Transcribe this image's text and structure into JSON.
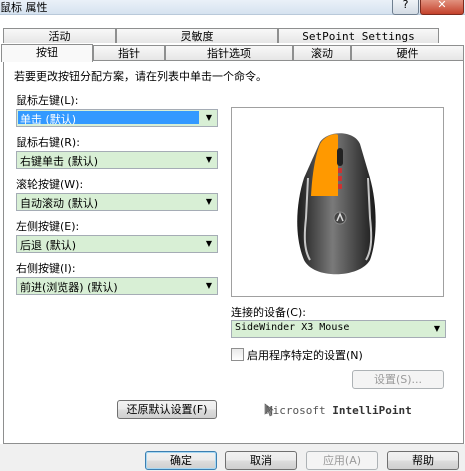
{
  "window": {
    "title": "鼠标 属性",
    "help_label": "?",
    "close_label": "✕"
  },
  "tabs_back": [
    {
      "label": "活动"
    },
    {
      "label": "灵敏度"
    },
    {
      "label": "SetPoint Settings"
    }
  ],
  "tabs_front": [
    {
      "label": "按钮",
      "selected": true
    },
    {
      "label": "指针"
    },
    {
      "label": "指针选项"
    },
    {
      "label": "滚动"
    },
    {
      "label": "硬件"
    }
  ],
  "instructions": "若要更改按钮分配方案，请在列表中单击一个命令。",
  "buttons": [
    {
      "label": "鼠标左键(L):",
      "value": "单击 (默认)"
    },
    {
      "label": "鼠标右键(R):",
      "value": "右键单击 (默认)"
    },
    {
      "label": "滚轮按键(W):",
      "value": "自动滚动 (默认)"
    },
    {
      "label": "左侧按键(E):",
      "value": "后退 (默认)"
    },
    {
      "label": "右侧按键(I):",
      "value": "前进(浏览器) (默认)"
    }
  ],
  "device": {
    "label": "连接的设备(C):",
    "value": "SideWinder X3 Mouse"
  },
  "checkbox": {
    "label": "启用程序特定的设置(N)",
    "checked": false
  },
  "settings_button": "设置(S)...",
  "restore_button": "还原默认设置(F)",
  "brand": {
    "prefix": "Microsoft ",
    "name": "IntelliPoint"
  },
  "footer": {
    "ok": "确定",
    "cancel": "取消",
    "apply": "应用(A)",
    "help": "帮助"
  },
  "colors": {
    "combo_bg": "#d8efd5",
    "selection": "#3399ff",
    "mouse_highlight": "#ff9900"
  },
  "icons": {
    "dropdown": "chevron-down-icon",
    "mouse_preview": "mouse-icon",
    "brand_cursor": "cursor-icon"
  }
}
